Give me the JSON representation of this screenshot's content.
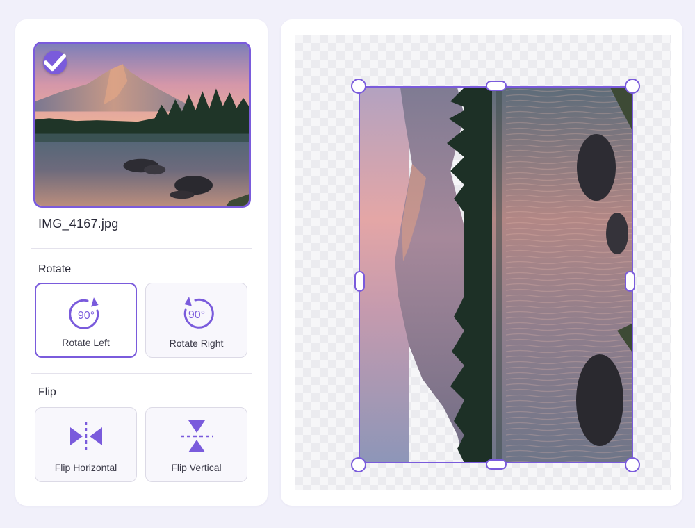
{
  "file": {
    "name": "IMG_4167.jpg",
    "selected": true
  },
  "rotate": {
    "title": "Rotate",
    "left": {
      "label": "Rotate Left",
      "degrees": "90°",
      "active": true
    },
    "right": {
      "label": "Rotate Right",
      "degrees": "90°",
      "active": false
    }
  },
  "flip": {
    "title": "Flip",
    "horizontal": {
      "label": "Flip Horizontal"
    },
    "vertical": {
      "label": "Flip Vertical"
    }
  },
  "colors": {
    "accent": "#7a5bdc",
    "background": "#f1f0fa",
    "panel": "#ffffff"
  },
  "icons": {
    "selected": "check-icon",
    "rotate_left": "rotate-left-icon",
    "rotate_right": "rotate-right-icon",
    "flip_horizontal": "flip-horizontal-icon",
    "flip_vertical": "flip-vertical-icon"
  }
}
